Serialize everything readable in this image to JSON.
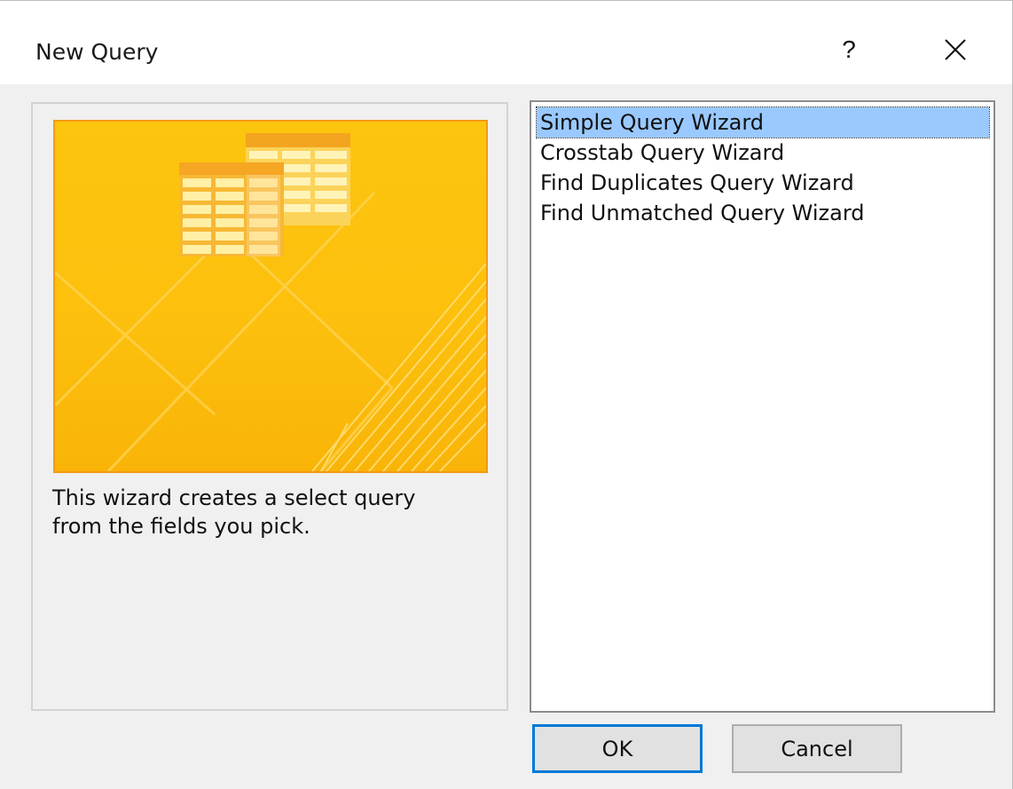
{
  "window": {
    "title": "New Query",
    "help_label": "?",
    "close_icon": "close-icon"
  },
  "preview": {
    "image_icon": "query-wizard-illustration",
    "description": "This wizard creates a select query\nfrom the fields you pick."
  },
  "wizard_list": {
    "items": [
      {
        "label": "Simple Query Wizard",
        "selected": true
      },
      {
        "label": "Crosstab Query Wizard",
        "selected": false
      },
      {
        "label": "Find Duplicates Query Wizard",
        "selected": false
      },
      {
        "label": "Find Unmatched Query Wizard",
        "selected": false
      }
    ]
  },
  "buttons": {
    "ok_label": "OK",
    "cancel_label": "Cancel"
  },
  "colors": {
    "accent": "#0078d7",
    "selection": "#99c9ff",
    "illustration_orange": "#fcc50e"
  }
}
